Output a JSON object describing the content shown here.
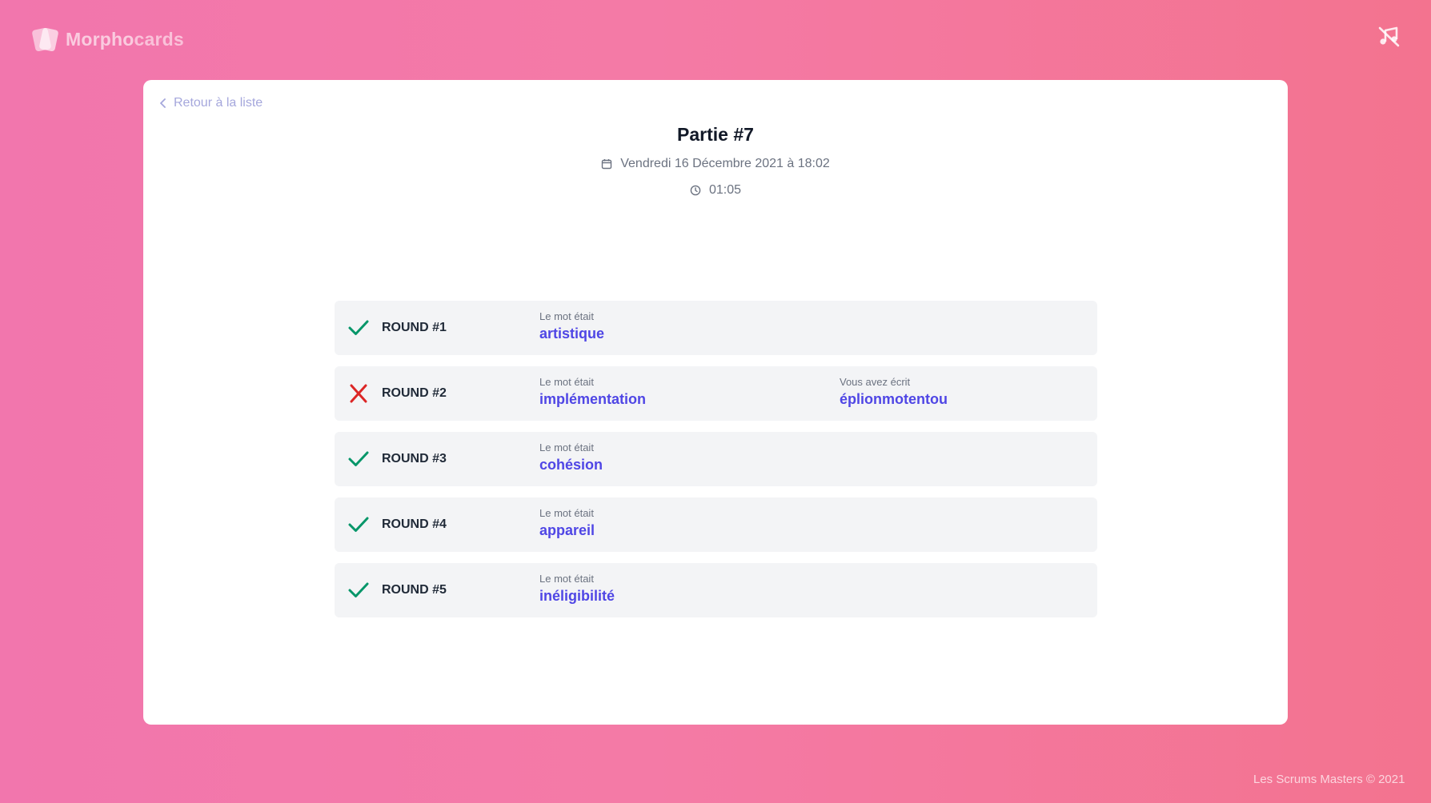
{
  "app": {
    "logo_prefix": "Morpho",
    "logo_suffix": "cards"
  },
  "nav": {
    "back_label": "Retour à la liste"
  },
  "game": {
    "title": "Partie #7",
    "date": "Vendredi 16 Décembre 2021 à 18:02",
    "duration": "01:05"
  },
  "labels": {
    "word_caption": "Le mot était",
    "typed_caption": "Vous avez écrit"
  },
  "rounds": [
    {
      "label": "ROUND #1",
      "status": "success",
      "word": "artistique",
      "typed": ""
    },
    {
      "label": "ROUND #2",
      "status": "fail",
      "word": "implémentation",
      "typed": "éplionmotentou"
    },
    {
      "label": "ROUND #3",
      "status": "success",
      "word": "cohésion",
      "typed": ""
    },
    {
      "label": "ROUND #4",
      "status": "success",
      "word": "appareil",
      "typed": ""
    },
    {
      "label": "ROUND #5",
      "status": "success",
      "word": "inéligibilité",
      "typed": ""
    }
  ],
  "footer": {
    "copyright": "Les Scrums Masters © 2021"
  },
  "colors": {
    "success": "#059669",
    "fail": "#dc2626",
    "accent": "#4f46e5"
  },
  "icons": {
    "back": "chevron-left-icon",
    "date": "calendar-icon",
    "duration": "clock-icon",
    "music": "music-off-icon",
    "success": "check-icon",
    "fail": "x-icon"
  }
}
